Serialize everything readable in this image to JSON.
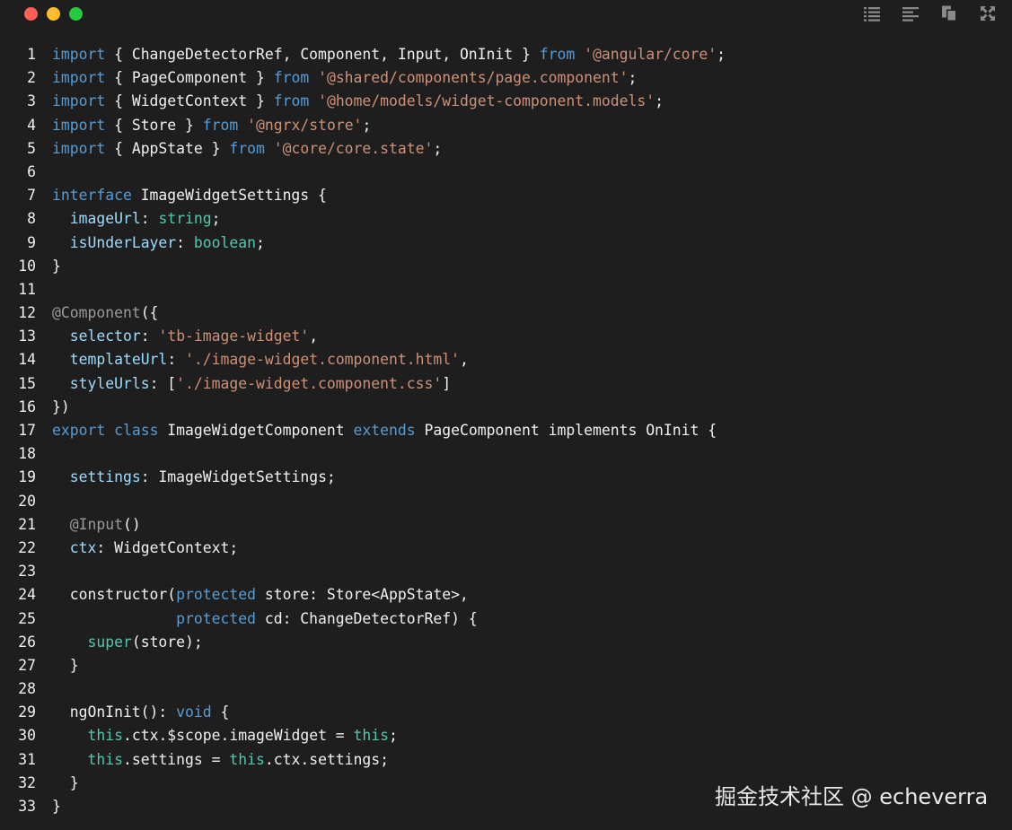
{
  "window": {
    "controls": [
      {
        "name": "close",
        "color": "#ff5f56"
      },
      {
        "name": "minimize",
        "color": "#ffbd2e"
      },
      {
        "name": "maximize",
        "color": "#27c93f"
      }
    ],
    "toolbar_icons": [
      "list-icon",
      "align-left-icon",
      "copy-icon",
      "fullscreen-icon"
    ]
  },
  "colors": {
    "background": "#1e1e1e",
    "text": "#f0f0f0",
    "keyword": "#569cd6",
    "string": "#ce9178",
    "type": "#4ec9b0",
    "property": "#9cdcfe",
    "decorator": "#9a9a9a"
  },
  "code": {
    "lines": [
      [
        [
          "kw",
          "import"
        ],
        [
          "pl",
          " { ChangeDetectorRef, Component, Input, OnInit } "
        ],
        [
          "kw",
          "from"
        ],
        [
          "pl",
          " "
        ],
        [
          "str",
          "'@angular/core'"
        ],
        [
          "pl",
          ";"
        ]
      ],
      [
        [
          "kw",
          "import"
        ],
        [
          "pl",
          " { PageComponent } "
        ],
        [
          "kw",
          "from"
        ],
        [
          "pl",
          " "
        ],
        [
          "str",
          "'@shared/components/page.component'"
        ],
        [
          "pl",
          ";"
        ]
      ],
      [
        [
          "kw",
          "import"
        ],
        [
          "pl",
          " { WidgetContext } "
        ],
        [
          "kw",
          "from"
        ],
        [
          "pl",
          " "
        ],
        [
          "str",
          "'@home/models/widget-component.models'"
        ],
        [
          "pl",
          ";"
        ]
      ],
      [
        [
          "kw",
          "import"
        ],
        [
          "pl",
          " { Store } "
        ],
        [
          "kw",
          "from"
        ],
        [
          "pl",
          " "
        ],
        [
          "str",
          "'@ngrx/store'"
        ],
        [
          "pl",
          ";"
        ]
      ],
      [
        [
          "kw",
          "import"
        ],
        [
          "pl",
          " { AppState } "
        ],
        [
          "kw",
          "from"
        ],
        [
          "pl",
          " "
        ],
        [
          "str",
          "'@core/core.state'"
        ],
        [
          "pl",
          ";"
        ]
      ],
      [],
      [
        [
          "kw",
          "interface"
        ],
        [
          "pl",
          " ImageWidgetSettings {"
        ]
      ],
      [
        [
          "pl",
          "  "
        ],
        [
          "prop",
          "imageUrl"
        ],
        [
          "pl",
          ": "
        ],
        [
          "ty",
          "string"
        ],
        [
          "pl",
          ";"
        ]
      ],
      [
        [
          "pl",
          "  "
        ],
        [
          "prop",
          "isUnderLayer"
        ],
        [
          "pl",
          ": "
        ],
        [
          "ty",
          "boolean"
        ],
        [
          "pl",
          ";"
        ]
      ],
      [
        [
          "pl",
          "}"
        ]
      ],
      [],
      [
        [
          "dec",
          "@Component"
        ],
        [
          "pl",
          "({"
        ]
      ],
      [
        [
          "pl",
          "  "
        ],
        [
          "prop",
          "selector"
        ],
        [
          "pl",
          ": "
        ],
        [
          "str",
          "'tb-image-widget'"
        ],
        [
          "pl",
          ","
        ]
      ],
      [
        [
          "pl",
          "  "
        ],
        [
          "prop",
          "templateUrl"
        ],
        [
          "pl",
          ": "
        ],
        [
          "str",
          "'./image-widget.component.html'"
        ],
        [
          "pl",
          ","
        ]
      ],
      [
        [
          "pl",
          "  "
        ],
        [
          "prop",
          "styleUrls"
        ],
        [
          "pl",
          ": ["
        ],
        [
          "str",
          "'./image-widget.component.css'"
        ],
        [
          "pl",
          "]"
        ]
      ],
      [
        [
          "pl",
          "})"
        ]
      ],
      [
        [
          "kw",
          "export"
        ],
        [
          "pl",
          " "
        ],
        [
          "kw",
          "class"
        ],
        [
          "pl",
          " ImageWidgetComponent "
        ],
        [
          "kw",
          "extends"
        ],
        [
          "pl",
          " PageComponent implements OnInit {"
        ]
      ],
      [],
      [
        [
          "pl",
          "  "
        ],
        [
          "prop",
          "settings"
        ],
        [
          "pl",
          ": ImageWidgetSettings;"
        ]
      ],
      [],
      [
        [
          "pl",
          "  "
        ],
        [
          "dec",
          "@Input"
        ],
        [
          "pl",
          "()"
        ]
      ],
      [
        [
          "pl",
          "  "
        ],
        [
          "prop",
          "ctx"
        ],
        [
          "pl",
          ": WidgetContext;"
        ]
      ],
      [],
      [
        [
          "pl",
          "  constructor("
        ],
        [
          "kw",
          "protected"
        ],
        [
          "pl",
          " store: Store<AppState>,"
        ]
      ],
      [
        [
          "pl",
          "              "
        ],
        [
          "kw",
          "protected"
        ],
        [
          "pl",
          " cd: ChangeDetectorRef) {"
        ]
      ],
      [
        [
          "pl",
          "    "
        ],
        [
          "ty",
          "super"
        ],
        [
          "pl",
          "(store);"
        ]
      ],
      [
        [
          "pl",
          "  }"
        ]
      ],
      [],
      [
        [
          "pl",
          "  ngOnInit(): "
        ],
        [
          "kw",
          "void"
        ],
        [
          "pl",
          " {"
        ]
      ],
      [
        [
          "pl",
          "    "
        ],
        [
          "ty",
          "this"
        ],
        [
          "pl",
          ".ctx.$scope.imageWidget = "
        ],
        [
          "ty",
          "this"
        ],
        [
          "pl",
          ";"
        ]
      ],
      [
        [
          "pl",
          "    "
        ],
        [
          "ty",
          "this"
        ],
        [
          "pl",
          ".settings = "
        ],
        [
          "ty",
          "this"
        ],
        [
          "pl",
          ".ctx.settings;"
        ]
      ],
      [
        [
          "pl",
          "  }"
        ]
      ],
      [
        [
          "pl",
          "}"
        ]
      ]
    ]
  },
  "watermark": "掘金技术社区 @ echeverra"
}
